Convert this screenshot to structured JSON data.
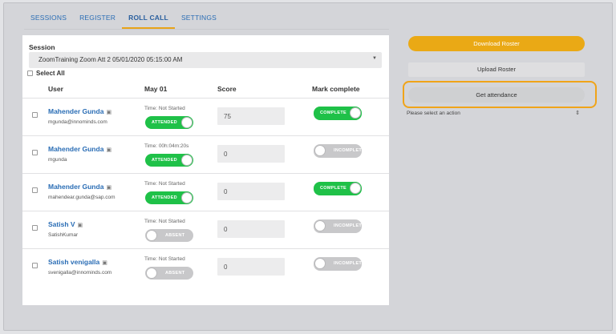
{
  "tabs": [
    {
      "label": "SESSIONS"
    },
    {
      "label": "REGISTER"
    },
    {
      "label": "ROLL CALL",
      "active": true
    },
    {
      "label": "SETTINGS"
    }
  ],
  "session": {
    "label": "Session",
    "value": "ZoomTraining Zoom Att 2 05/01/2020 05:15:00 AM"
  },
  "select_all": "Select All",
  "columns": {
    "user": "User",
    "date": "May 01",
    "score": "Score",
    "mark": "Mark complete"
  },
  "rows": [
    {
      "name": "Mahender Gunda",
      "email": "mgunda@innominds.com",
      "time": "Time: Not Started",
      "attendance": "ATTENDED",
      "attended": true,
      "score": "75",
      "mark": "COMPLETE",
      "complete": true
    },
    {
      "name": "Mahender Gunda",
      "email": "mgunda",
      "time": "Time: 00h:04m:20s",
      "attendance": "ATTENDED",
      "attended": true,
      "score": "0",
      "mark": "INCOMPLETE",
      "complete": false
    },
    {
      "name": "Mahender Gunda",
      "email": "mahendear.gunda@sap.com",
      "time": "Time: Not Started",
      "attendance": "ATTENDED",
      "attended": true,
      "score": "0",
      "mark": "COMPLETE",
      "complete": true
    },
    {
      "name": "Satish V",
      "email": "SatishKumar",
      "time": "Time: Not Started",
      "attendance": "ABSENT",
      "attended": false,
      "score": "0",
      "mark": "INCOMPLETE",
      "complete": false
    },
    {
      "name": "Satish venigalla",
      "email": "svenigalla@innominds.com",
      "time": "Time: Not Started",
      "attendance": "ABSENT",
      "attended": false,
      "score": "0",
      "mark": "INCOMPLETE",
      "complete": false
    }
  ],
  "actions": {
    "download": "Download Roster",
    "upload": "Upload Roster",
    "attendance": "Get attendance",
    "select_placeholder": "Please select an action"
  },
  "colors": {
    "accent": "#eaa915",
    "toggle_on": "#1fc148",
    "toggle_off": "#c8c8ca",
    "link": "#2a6db5"
  }
}
